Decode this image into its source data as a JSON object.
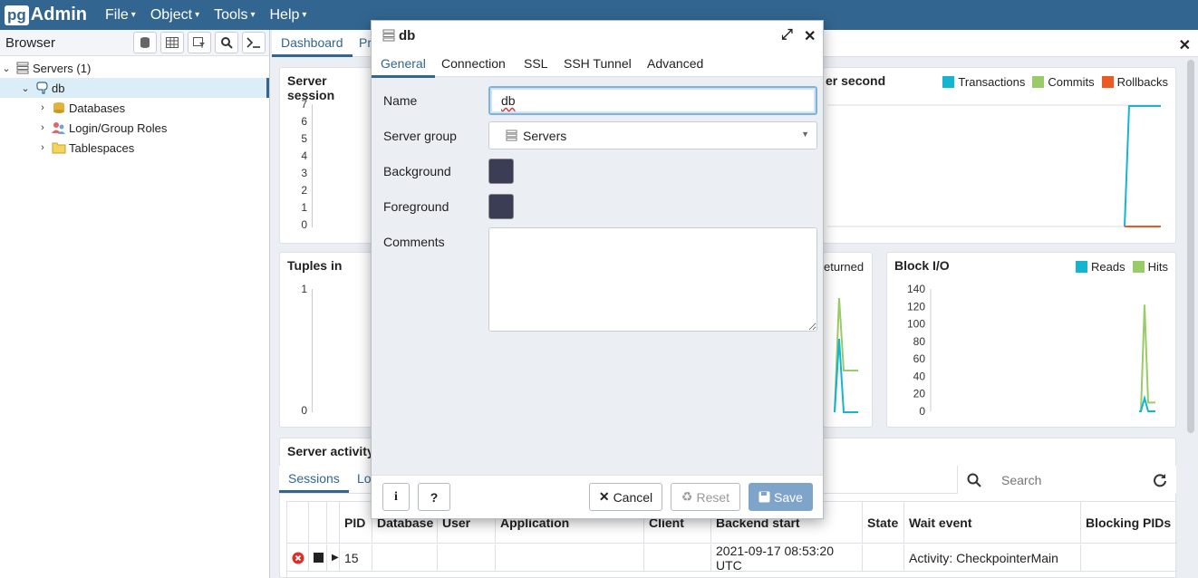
{
  "app": {
    "logo_pg": "pg",
    "logo_admin": "Admin"
  },
  "menu": [
    {
      "label": "File"
    },
    {
      "label": "Object"
    },
    {
      "label": "Tools"
    },
    {
      "label": "Help"
    }
  ],
  "browser": {
    "title": "Browser",
    "tree": {
      "servers": "Servers (1)",
      "db": "db",
      "databases": "Databases",
      "roles": "Login/Group Roles",
      "tablespaces": "Tablespaces"
    }
  },
  "main_tabs": {
    "dashboard": "Dashboard",
    "properties_partial": "Pr"
  },
  "charts": {
    "server_sessions": {
      "title": "Server session",
      "yticks": [
        "7",
        "6",
        "5",
        "4",
        "3",
        "2",
        "1",
        "0"
      ]
    },
    "tps": {
      "title": "er second",
      "legend": [
        {
          "name": "Transactions",
          "color": "#14b5d0"
        },
        {
          "name": "Commits",
          "color": "#99cc66"
        },
        {
          "name": "Rollbacks",
          "color": "#ea5a22"
        }
      ]
    },
    "tuples_in": {
      "title": "Tuples in",
      "yticks": [
        "1",
        "0"
      ]
    },
    "tuples_out": {
      "legend_partial": "eturned"
    },
    "block_io": {
      "title": "Block I/O",
      "legend": [
        {
          "name": "Reads",
          "color": "#14b5d0"
        },
        {
          "name": "Hits",
          "color": "#99cc66"
        }
      ],
      "yticks": [
        "140",
        "120",
        "100",
        "80",
        "60",
        "40",
        "20",
        "0"
      ]
    }
  },
  "chart_data": [
    {
      "type": "line",
      "title": "Block I/O",
      "series": [
        {
          "name": "Reads",
          "values": [
            0,
            0,
            0,
            15,
            0,
            0,
            0
          ]
        },
        {
          "name": "Hits",
          "values": [
            0,
            0,
            0,
            122,
            10,
            10,
            10
          ]
        }
      ],
      "ylim": [
        0,
        140
      ]
    }
  ],
  "server_activity": {
    "title": "Server activity",
    "tabs": {
      "sessions": "Sessions",
      "locks_partial": "Lo"
    },
    "search_placeholder": "Search",
    "columns": [
      "PID",
      "Database",
      "User",
      "Application",
      "Client",
      "Backend start",
      "State",
      "Wait event",
      "Blocking PIDs"
    ],
    "rows": [
      {
        "pid": "15",
        "backend_start": "2021-09-17 08:53:20 UTC",
        "wait_event": "Activity: CheckpointerMain"
      }
    ]
  },
  "dialog": {
    "title": "db",
    "tabs": [
      "General",
      "Connection",
      "SSL",
      "SSH Tunnel",
      "Advanced"
    ],
    "fields": {
      "name_label": "Name",
      "name_value": "db",
      "server_group_label": "Server group",
      "server_group_value": "Servers",
      "background_label": "Background",
      "background_color": "#3b3d55",
      "foreground_label": "Foreground",
      "foreground_color": "#3b3d55",
      "comments_label": "Comments",
      "comments_value": ""
    },
    "buttons": {
      "info": "i",
      "help": "?",
      "cancel": "Cancel",
      "reset": "Reset",
      "save": "Save"
    }
  }
}
